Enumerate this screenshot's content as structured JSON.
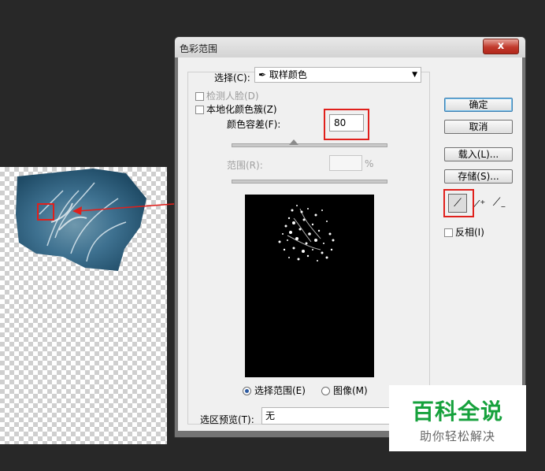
{
  "dialog": {
    "title": "色彩范围",
    "close_glyph": "x",
    "select_label": "选择(C):",
    "select_icon": "eyedropper-icon",
    "select_value": "取样颜色",
    "detect_faces_label": "检测人脸(D)",
    "localized_clusters_label": "本地化颜色簇(Z)",
    "fuzziness_label": "颜色容差(F):",
    "fuzziness_value": "80",
    "range_label": "范围(R):",
    "range_unit": "%",
    "radio_selection_label": "选择范围(E)",
    "radio_image_label": "图像(M)",
    "preview_label": "选区预览(T):",
    "preview_value": "无",
    "buttons": {
      "ok": "确定",
      "cancel": "取消",
      "load": "载入(L)...",
      "save": "存储(S)..."
    },
    "invert_label": "反相(I)",
    "eyedroppers": [
      "eyedropper-icon",
      "eyedropper-plus-icon",
      "eyedropper-minus-icon"
    ]
  },
  "watermark": {
    "main": "百科全说",
    "sub": "助你轻松解决"
  },
  "colors": {
    "highlight": "#e0201c",
    "water": "#2e5f78",
    "watermark_green": "#16a13c"
  }
}
